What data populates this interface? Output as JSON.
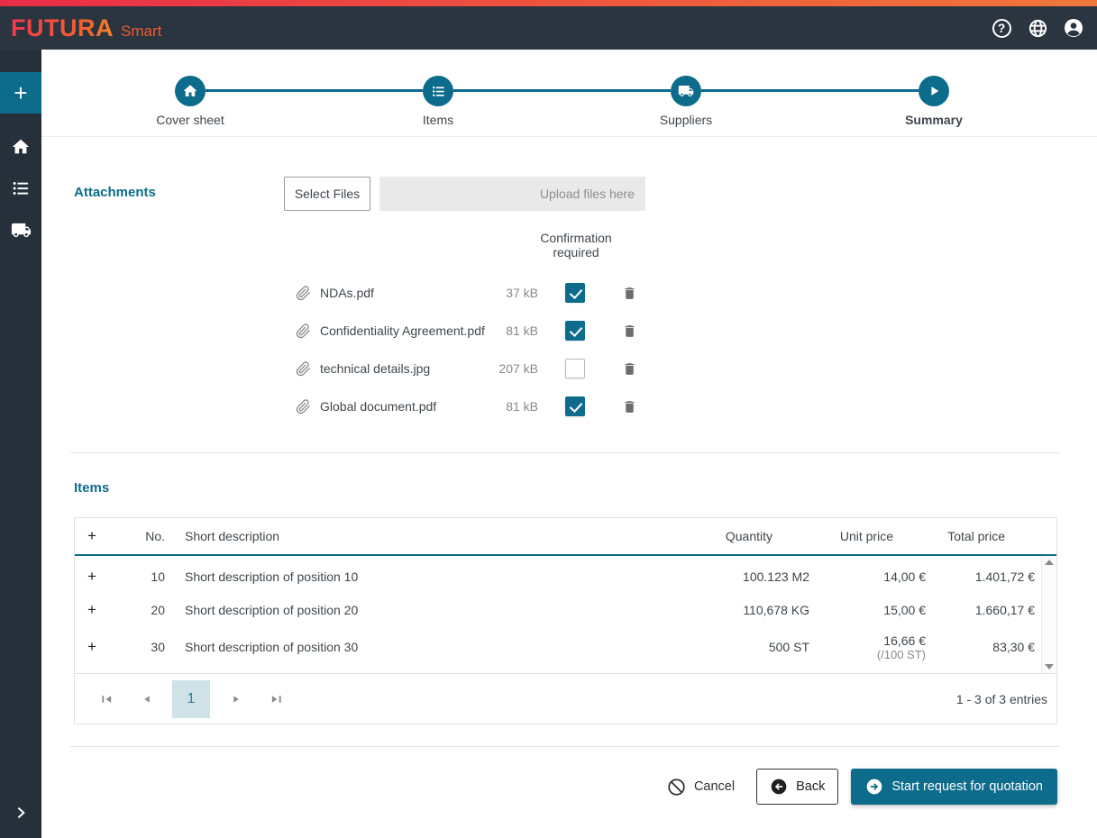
{
  "header": {
    "logo": "FUTURA",
    "logo_suffix": "Smart",
    "icons": {
      "help": "question-circle",
      "language": "globe",
      "account": "person-circle"
    }
  },
  "sidebar": {
    "plus_label": "+",
    "items": [
      {
        "icon": "home-icon"
      },
      {
        "icon": "list-icon"
      },
      {
        "icon": "truck-icon"
      }
    ],
    "expand_icon": "chevron-right"
  },
  "stepper": {
    "steps": [
      {
        "label": "Cover sheet",
        "icon": "home-icon",
        "active": false
      },
      {
        "label": "Items",
        "icon": "list-icon",
        "active": false
      },
      {
        "label": "Suppliers",
        "icon": "truck-icon",
        "active": false
      },
      {
        "label": "Summary",
        "icon": "play-icon",
        "active": true
      }
    ]
  },
  "attachments": {
    "title": "Attachments",
    "select_files_label": "Select Files",
    "dropzone_placeholder": "Upload files here",
    "confirmation_header": "Confirmation required",
    "files": [
      {
        "name": "NDAs.pdf",
        "size": "37 kB",
        "confirmation_required": true
      },
      {
        "name": "Confidentiality Agreement.pdf",
        "size": "81 kB",
        "confirmation_required": true
      },
      {
        "name": "technical details.jpg",
        "size": "207 kB",
        "confirmation_required": false
      },
      {
        "name": "Global document.pdf",
        "size": "81 kB",
        "confirmation_required": true
      }
    ]
  },
  "items": {
    "title": "Items",
    "columns": {
      "expand": "+",
      "no": "No.",
      "description": "Short description",
      "quantity": "Quantity",
      "unit_price": "Unit price",
      "total_price": "Total price"
    },
    "rows": [
      {
        "no": "10",
        "description": "Short description of position 10",
        "quantity": "100.123 M2",
        "unit_price": "14,00 €",
        "unit_price_note": "",
        "total_price": "1.401,72 €"
      },
      {
        "no": "20",
        "description": "Short description of position 20",
        "quantity": "110,678 KG",
        "unit_price": "15,00 €",
        "unit_price_note": "",
        "total_price": "1.660,17 €"
      },
      {
        "no": "30",
        "description": "Short description of position 30",
        "quantity": "500 ST",
        "unit_price": "16,66 €",
        "unit_price_note": "(/100 ST)",
        "total_price": "83,30 €"
      }
    ],
    "pagination": {
      "current_page": "1",
      "summary": "1 - 3 of 3 entries"
    }
  },
  "footer": {
    "cancel_label": "Cancel",
    "back_label": "Back",
    "submit_label": "Start request for quotation"
  },
  "colors": {
    "accent_teal": "#0d6b8c",
    "header_bg": "#2b3540",
    "sidebar_bg": "#25303a",
    "strip_gradient": [
      "#e92d48",
      "#f0783a"
    ],
    "page_box_bg": "#cfe2e8",
    "checkbox_checked": "#0d6b8c"
  }
}
